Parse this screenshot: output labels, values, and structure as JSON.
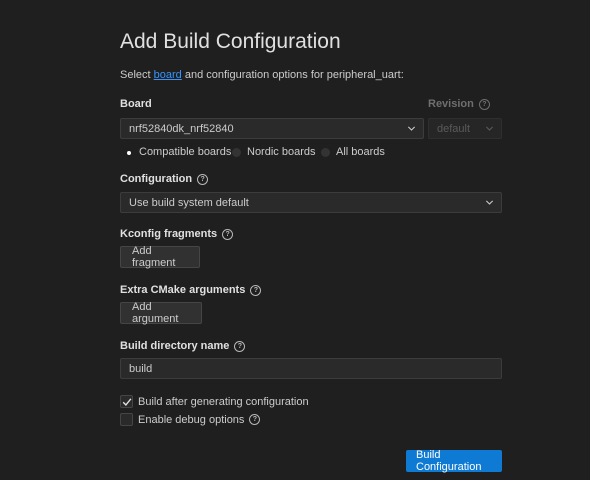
{
  "title": "Add Build Configuration",
  "subtitle": {
    "prefix": "Select ",
    "link": "board",
    "suffix": " and configuration options for peripheral_uart:"
  },
  "board": {
    "label": "Board",
    "selected": "nrf52840dk_nrf52840",
    "filters": [
      {
        "label": "Compatible boards",
        "selected": true
      },
      {
        "label": "Nordic boards",
        "selected": false
      },
      {
        "label": "All boards",
        "selected": false
      }
    ]
  },
  "revision": {
    "label": "Revision",
    "selected": "default"
  },
  "configuration": {
    "label": "Configuration",
    "selected": "Use build system default"
  },
  "kconfig": {
    "label": "Kconfig fragments",
    "button": "Add fragment"
  },
  "cmake": {
    "label": "Extra CMake arguments",
    "button": "Add argument"
  },
  "build_dir": {
    "label": "Build directory name",
    "value": "build"
  },
  "options": [
    {
      "label": "Build after generating configuration",
      "checked": true
    },
    {
      "label": "Enable debug options",
      "checked": false
    }
  ],
  "submit": "Build Configuration",
  "colors": {
    "background": "#1f1f1f",
    "accent": "#0e7ad3",
    "link": "#3794ff"
  }
}
